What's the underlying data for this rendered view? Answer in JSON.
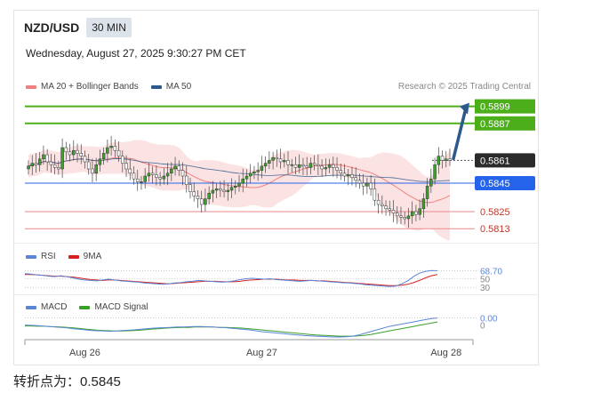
{
  "header": {
    "pair": "NZD/USD",
    "timeframe": "30 MIN"
  },
  "datetime": "Wednesday, August 27, 2025 9:30:27 PM CET",
  "credit": "Research © 2025 Trading Central",
  "legend": [
    {
      "label": "MA 20 + Bollinger Bands",
      "color": "#f08080"
    },
    {
      "label": "MA 50",
      "color": "#2c5a8c"
    }
  ],
  "rsi_legend": [
    {
      "label": "RSI",
      "color": "#5b86d6"
    },
    {
      "label": "9MA",
      "color": "#d62020"
    }
  ],
  "macd_legend": [
    {
      "label": "MACD",
      "color": "#5b86d6"
    },
    {
      "label": "MACD Signal",
      "color": "#3aa02a"
    }
  ],
  "footer": "转折点为：0.5845",
  "colors": {
    "up": "#3aa02a",
    "down": "#c0392b",
    "pivot": "#2563eb",
    "target": "#4caf1a",
    "arrow": "#2c5a8c",
    "band": "#fcdede"
  },
  "chart_data": {
    "type": "candlestick",
    "title": "NZD/USD",
    "x_tick_labels": [
      "Aug 26",
      "Aug 27",
      "Aug 28"
    ],
    "x_tick_positions": [
      15,
      62,
      111
    ],
    "ylim": [
      0.5805,
      0.5905
    ],
    "levels": [
      {
        "value": 0.5899,
        "label": "0.5899",
        "kind": "target"
      },
      {
        "value": 0.5887,
        "label": "0.5887",
        "kind": "target"
      },
      {
        "value": 0.5861,
        "label": "0.5861",
        "kind": "current"
      },
      {
        "value": 0.5845,
        "label": "0.5845",
        "kind": "pivot"
      },
      {
        "value": 0.5825,
        "label": "0.5825",
        "kind": "support"
      },
      {
        "value": 0.5813,
        "label": "0.5813",
        "kind": "support"
      }
    ],
    "closes": [
      0.5857,
      0.5859,
      0.5858,
      0.5862,
      0.5865,
      0.586,
      0.5858,
      0.5856,
      0.5855,
      0.587,
      0.5867,
      0.5865,
      0.5868,
      0.5866,
      0.5864,
      0.586,
      0.5855,
      0.5852,
      0.5858,
      0.5862,
      0.5866,
      0.587,
      0.5871,
      0.5868,
      0.5864,
      0.5859,
      0.5855,
      0.5852,
      0.5848,
      0.5846,
      0.5846,
      0.585,
      0.5852,
      0.5851,
      0.5849,
      0.5848,
      0.585,
      0.5852,
      0.5855,
      0.5857,
      0.5854,
      0.585,
      0.5844,
      0.5839,
      0.5836,
      0.5834,
      0.583,
      0.5834,
      0.5838,
      0.584,
      0.5841,
      0.584,
      0.5839,
      0.584,
      0.5842,
      0.5843,
      0.5845,
      0.5848,
      0.585,
      0.5852,
      0.5853,
      0.5854,
      0.5857,
      0.5859,
      0.5861,
      0.5863,
      0.5862,
      0.586,
      0.5861,
      0.5858,
      0.5858,
      0.5856,
      0.5858,
      0.5857,
      0.5856,
      0.5859,
      0.5858,
      0.5857,
      0.5855,
      0.5856,
      0.5858,
      0.5856,
      0.5854,
      0.5852,
      0.585,
      0.5851,
      0.5849,
      0.5847,
      0.5845,
      0.5843,
      0.5845,
      0.5841,
      0.5833,
      0.583,
      0.5829,
      0.5827,
      0.5826,
      0.5824,
      0.5822,
      0.5821,
      0.582,
      0.5822,
      0.5825,
      0.5823,
      0.5827,
      0.5834,
      0.5843,
      0.5848,
      0.5858,
      0.5864,
      0.5861,
      0.5862,
      0.5861
    ],
    "rsi_level_labels": [
      "68.70",
      "50",
      "30"
    ],
    "rsi_last": 68.7,
    "macd_level_labels": [
      "0.00",
      "0"
    ],
    "rsi": [
      62,
      61,
      59,
      58,
      56,
      55,
      57,
      55,
      52,
      49,
      47,
      46,
      45,
      47,
      49,
      47,
      45,
      44,
      43,
      42,
      40,
      39,
      38,
      37,
      38,
      40,
      41,
      43,
      44,
      46,
      45,
      44,
      43,
      42,
      43,
      45,
      48,
      50,
      51,
      50,
      49,
      50,
      48,
      47,
      46,
      45,
      44,
      45,
      46,
      45,
      44,
      43,
      42,
      41,
      40,
      39,
      38,
      36,
      35,
      34,
      33,
      32,
      33,
      38,
      45,
      55,
      63,
      67,
      69,
      68.7
    ],
    "rsi_ma": [
      60,
      60,
      59,
      58,
      57,
      56,
      56,
      55,
      54,
      52,
      50,
      48,
      47,
      46,
      47,
      47,
      46,
      45,
      44,
      43,
      42,
      41,
      40,
      39,
      38,
      39,
      40,
      41,
      42,
      43,
      44,
      44,
      44,
      43,
      43,
      43,
      44,
      46,
      47,
      48,
      49,
      49,
      49,
      48,
      47,
      47,
      46,
      46,
      46,
      45,
      45,
      44,
      43,
      42,
      41,
      40,
      39,
      38,
      37,
      36,
      35,
      34,
      34,
      35,
      37,
      41,
      46,
      52,
      57,
      60
    ],
    "macd": [
      55,
      54,
      53,
      52,
      50,
      48,
      47,
      45,
      42,
      40,
      38,
      36,
      35,
      34,
      33,
      34,
      36,
      37,
      38,
      40,
      42,
      44,
      45,
      46,
      47,
      48,
      48,
      49,
      50,
      50,
      49,
      48,
      47,
      46,
      44,
      42,
      40,
      38,
      35,
      32,
      30,
      28,
      26,
      24,
      22,
      20,
      18,
      17,
      16,
      15,
      14,
      13,
      13,
      14,
      16,
      20,
      26,
      32,
      38,
      44,
      50,
      54,
      58,
      62,
      66,
      70,
      74,
      78,
      80
    ],
    "macd_signal": [
      52,
      52,
      51,
      51,
      50,
      49,
      48,
      47,
      45,
      43,
      41,
      39,
      37,
      36,
      35,
      34,
      34,
      35,
      36,
      37,
      39,
      41,
      42,
      44,
      45,
      46,
      47,
      47,
      48,
      48,
      48,
      48,
      47,
      47,
      46,
      45,
      44,
      42,
      40,
      38,
      36,
      34,
      32,
      30,
      28,
      26,
      24,
      22,
      20,
      19,
      18,
      17,
      16,
      16,
      16,
      17,
      19,
      22,
      26,
      30,
      34,
      38,
      42,
      46,
      50,
      54,
      58,
      62,
      66
    ]
  }
}
